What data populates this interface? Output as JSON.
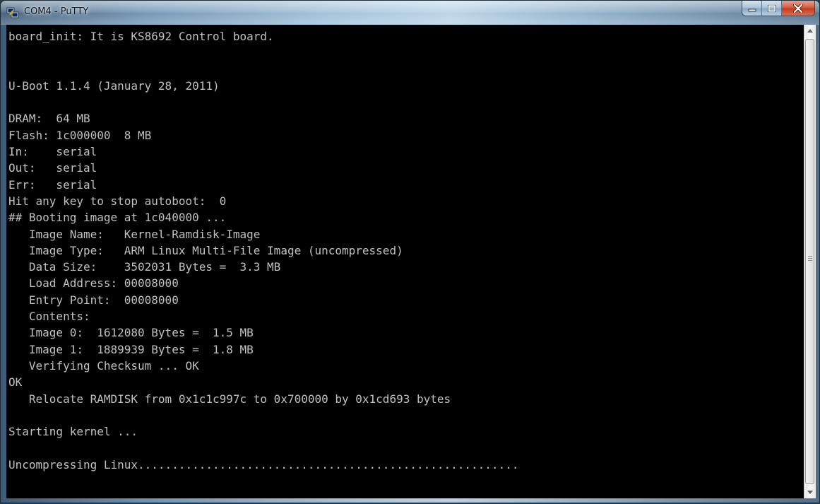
{
  "window": {
    "title": "COM4 - PuTTY",
    "icon": "putty-app-icon",
    "controls": {
      "minimize_icon": "minimize-icon",
      "maximize_icon": "maximize-icon",
      "close_icon": "close-icon"
    }
  },
  "terminal": {
    "background": "#000000",
    "foreground": "#c0c0c0",
    "lines": [
      "board_init: It is KS8692 Control board.",
      "",
      "",
      "U-Boot 1.1.4 (January 28, 2011)",
      "",
      "DRAM:  64 MB",
      "Flash: 1c000000  8 MB",
      "In:    serial",
      "Out:   serial",
      "Err:   serial",
      "Hit any key to stop autoboot:  0",
      "## Booting image at 1c040000 ...",
      "   Image Name:   Kernel-Ramdisk-Image",
      "   Image Type:   ARM Linux Multi-File Image (uncompressed)",
      "   Data Size:    3502031 Bytes =  3.3 MB",
      "   Load Address: 00008000",
      "   Entry Point:  00008000",
      "   Contents:",
      "   Image 0:  1612080 Bytes =  1.5 MB",
      "   Image 1:  1889939 Bytes =  1.8 MB",
      "   Verifying Checksum ... OK",
      "OK",
      "   Relocate RAMDISK from 0x1c1c997c to 0x700000 by 0x1cd693 bytes",
      "",
      "Starting kernel ...",
      "",
      "Uncompressing Linux........................................................"
    ]
  },
  "scrollbar": {
    "up_icon": "scroll-up-arrow-icon",
    "down_icon": "scroll-down-arrow-icon",
    "position_fraction": 0.97
  }
}
